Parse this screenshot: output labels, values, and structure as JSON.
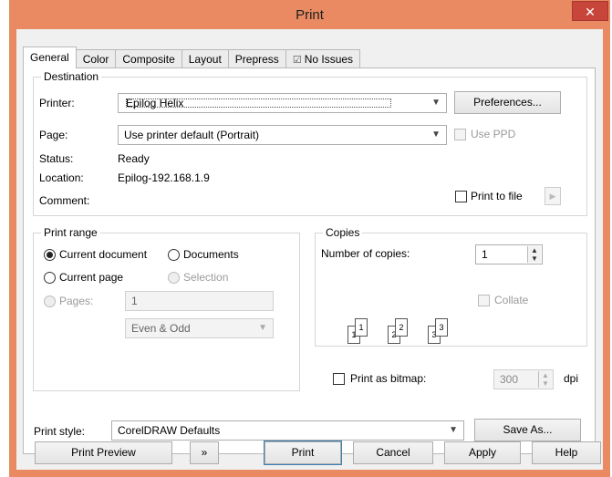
{
  "window": {
    "title": "Print",
    "close_glyph": "✕"
  },
  "tabs": [
    {
      "label": "General"
    },
    {
      "label": "Color"
    },
    {
      "label": "Composite"
    },
    {
      "label": "Layout"
    },
    {
      "label": "Prepress"
    },
    {
      "label": "No Issues",
      "icon": "checklist-icon"
    }
  ],
  "destination": {
    "title": "Destination",
    "printer_label": "Printer:",
    "printer_value": "Epilog Helix",
    "preferences_button": "Preferences...",
    "page_label": "Page:",
    "page_value": "Use printer default (Portrait)",
    "use_ppd": "Use PPD",
    "status_label": "Status:",
    "status_value": "Ready",
    "location_label": "Location:",
    "location_value": "Epilog-192.168.1.9",
    "comment_label": "Comment:",
    "print_to_file": "Print to file"
  },
  "print_range": {
    "title": "Print range",
    "current_document": "Current document",
    "documents": "Documents",
    "current_page": "Current page",
    "selection": "Selection",
    "pages_label": "Pages:",
    "pages_value": "1",
    "even_odd": "Even & Odd"
  },
  "copies": {
    "title": "Copies",
    "number_label": "Number of copies:",
    "number_value": "1",
    "collate": "Collate",
    "collate_pages": [
      "1",
      "1",
      "2",
      "2",
      "3",
      "3"
    ]
  },
  "bitmap": {
    "label": "Print as bitmap:",
    "dpi_value": "300",
    "dpi_unit": "dpi"
  },
  "print_style": {
    "label": "Print style:",
    "value": "CorelDRAW Defaults",
    "save_as": "Save As..."
  },
  "footer": {
    "print_preview": "Print Preview",
    "expand_glyph": "»",
    "print": "Print",
    "cancel": "Cancel",
    "apply": "Apply",
    "help": "Help"
  }
}
